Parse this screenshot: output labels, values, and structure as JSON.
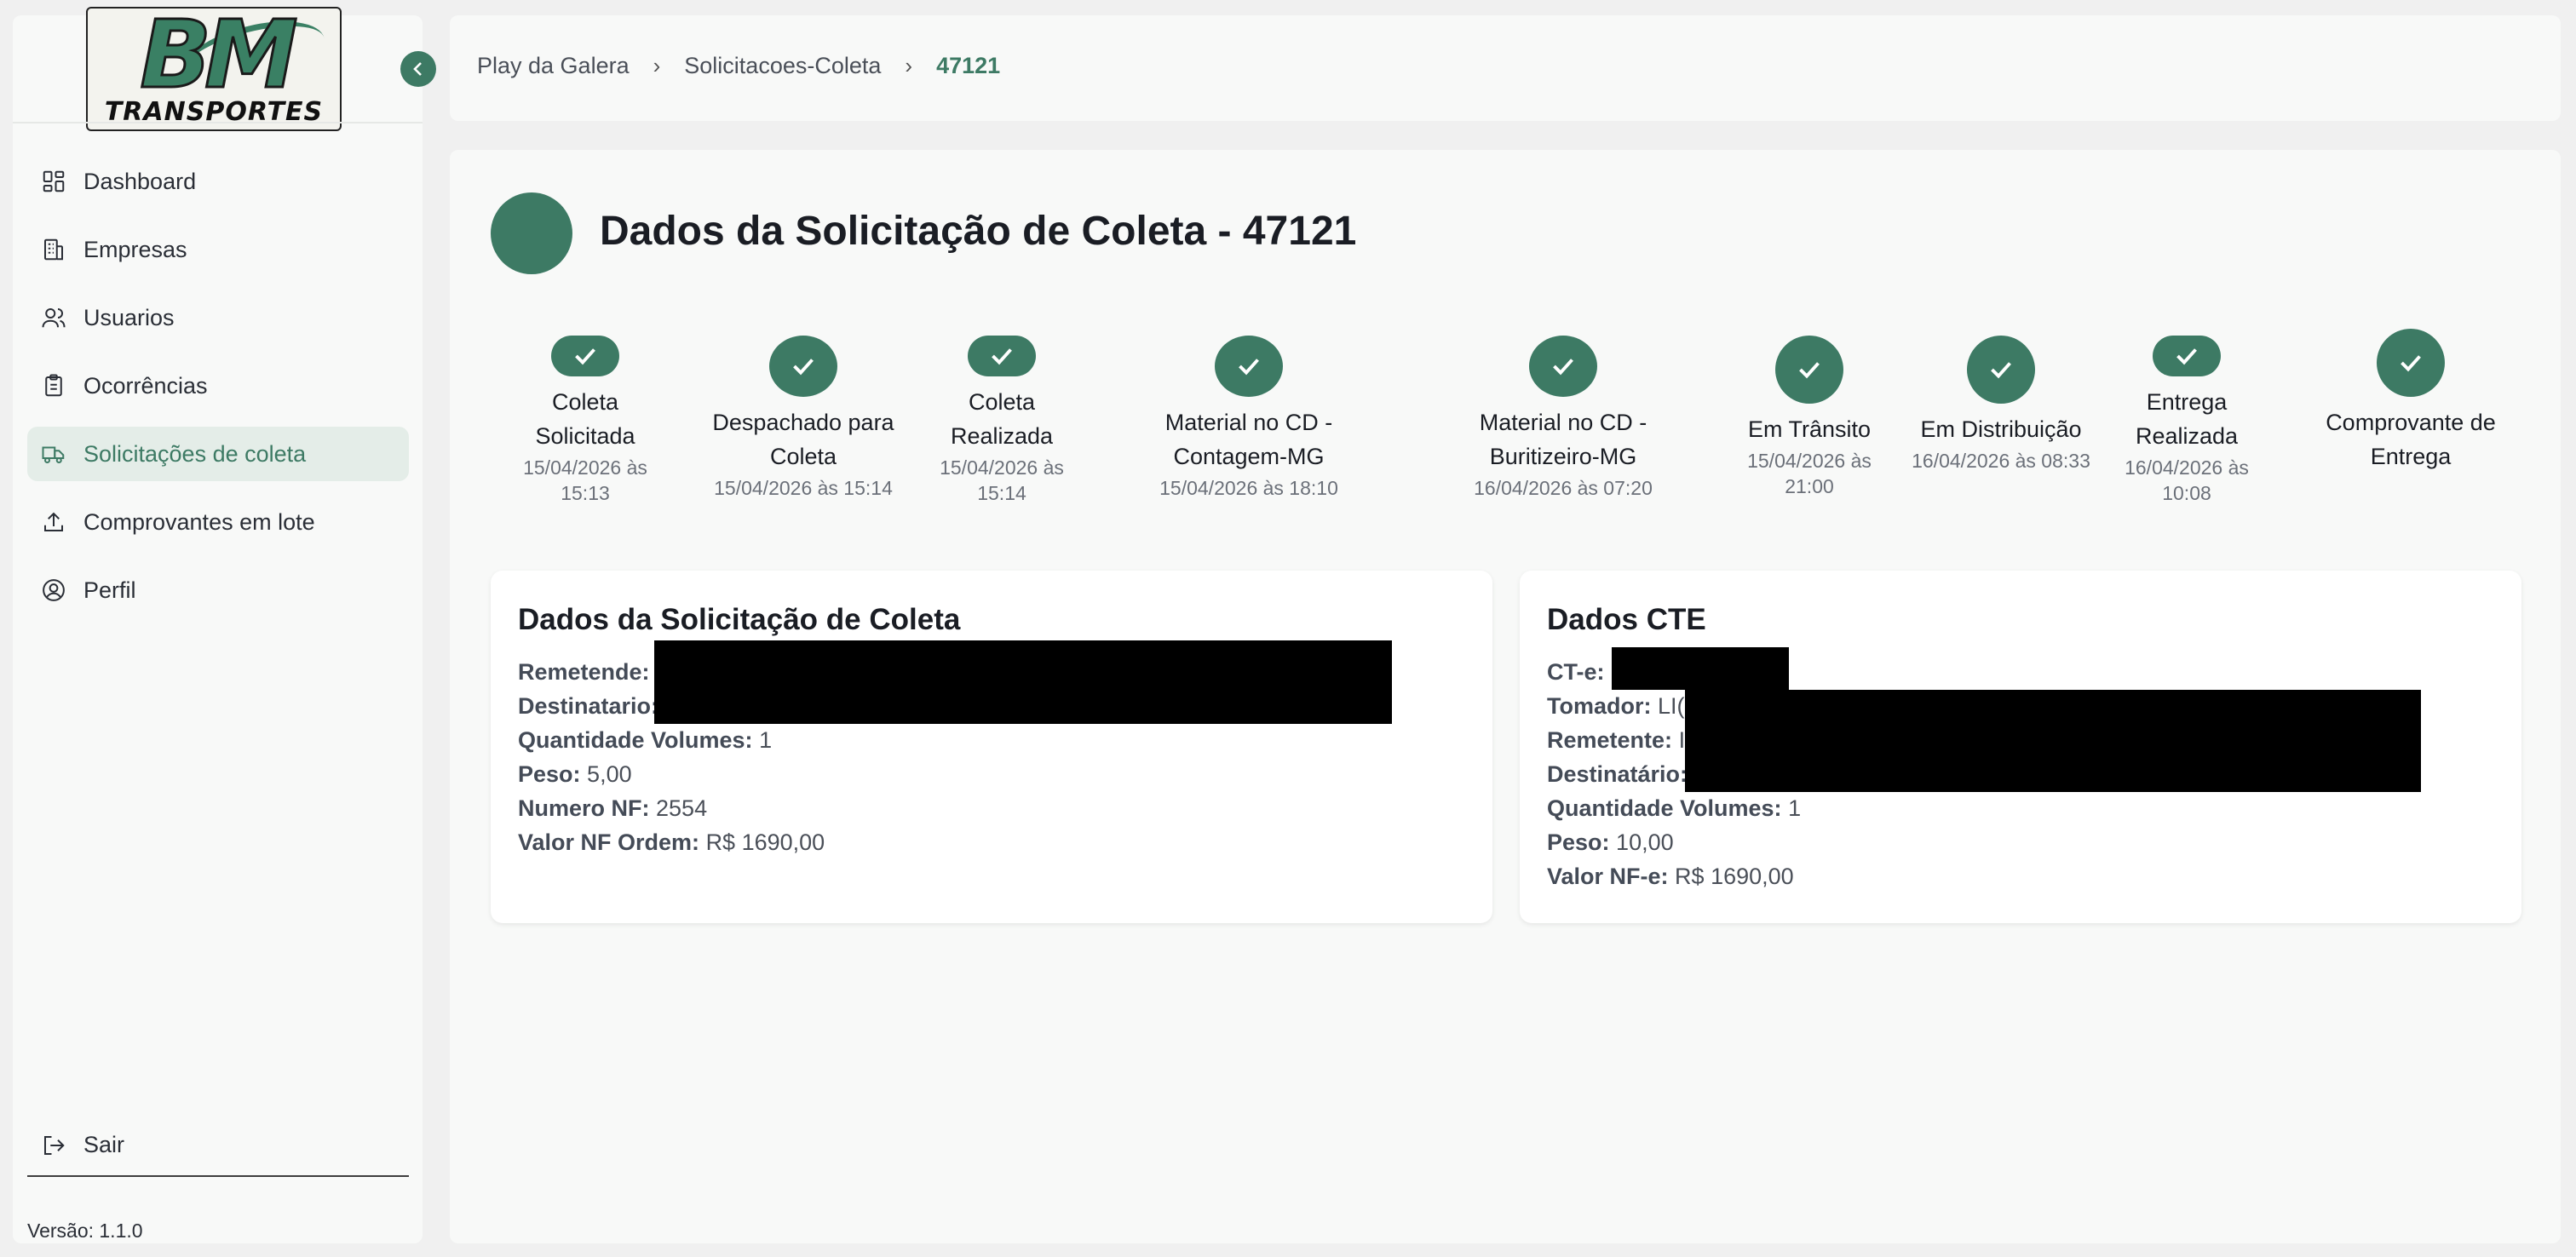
{
  "sidebar": {
    "logo_text": "BM TRANSPORTES",
    "logo_bm": "BM",
    "logo_sub": "TRANSPORTES",
    "items": [
      {
        "label": "Dashboard",
        "icon": "dashboard-icon"
      },
      {
        "label": "Empresas",
        "icon": "building-icon"
      },
      {
        "label": "Usuarios",
        "icon": "users-icon"
      },
      {
        "label": "Ocorrências",
        "icon": "clipboard-icon"
      },
      {
        "label": "Solicitações de coleta",
        "icon": "truck-icon",
        "active": true
      },
      {
        "label": "Comprovantes em lote",
        "icon": "upload-icon"
      },
      {
        "label": "Perfil",
        "icon": "user-circle-icon"
      }
    ],
    "logout_label": "Sair",
    "version": "Versão: 1.1.0"
  },
  "breadcrumb": {
    "items": [
      "Play da Galera",
      "Solicitacoes-Coleta"
    ],
    "current": "47121"
  },
  "page": {
    "title": "Dados da Solicitação de Coleta - 47121"
  },
  "timeline": [
    {
      "label": "Coleta Solicitada",
      "date": "15/04/2026 às 15:13"
    },
    {
      "label": "Despachado para Coleta",
      "date": "15/04/2026 às 15:14"
    },
    {
      "label": "Coleta Realizada",
      "date": "15/04/2026 às 15:14"
    },
    {
      "label": "Material no CD - Contagem-MG",
      "date": "15/04/2026 às 18:10"
    },
    {
      "label": "Material no CD - Buritizeiro-MG",
      "date": "16/04/2026 às 07:20"
    },
    {
      "label": "Em Trânsito",
      "date": "15/04/2026 às 21:00"
    },
    {
      "label": "Em Distribuição",
      "date": "16/04/2026 às 08:33"
    },
    {
      "label": "Entrega Realizada",
      "date": "16/04/2026 às 10:08"
    },
    {
      "label": "Comprovante de Entrega",
      "date": ""
    }
  ],
  "solicitacao_card": {
    "title": "Dados da Solicitação de Coleta",
    "fields": [
      {
        "label": "Remetende:",
        "value": ""
      },
      {
        "label": "Destinatario:",
        "value": ""
      },
      {
        "label": "Quantidade Volumes:",
        "value": "1"
      },
      {
        "label": "Peso:",
        "value": "5,00"
      },
      {
        "label": "Numero NF:",
        "value": "2554"
      },
      {
        "label": "Valor NF Ordem:",
        "value": "R$ 1690,00"
      }
    ]
  },
  "cte_card": {
    "title": "Dados CTE",
    "fields": [
      {
        "label": "CT-e:",
        "value": ""
      },
      {
        "label": "Tomador:",
        "value": "LI("
      },
      {
        "label": "Remetente:",
        "value": "I"
      },
      {
        "label": "Destinatário:",
        "value": ""
      },
      {
        "label": "Quantidade Volumes:",
        "value": "1"
      },
      {
        "label": "Peso:",
        "value": "10,00"
      },
      {
        "label": "Valor NF-e:",
        "value": "R$ 1690,00"
      }
    ]
  },
  "colors": {
    "accent": "#3d7a64",
    "active_bg": "#e4ede8",
    "panel_bg": "#f8f9f8",
    "redaction": "#000000"
  }
}
